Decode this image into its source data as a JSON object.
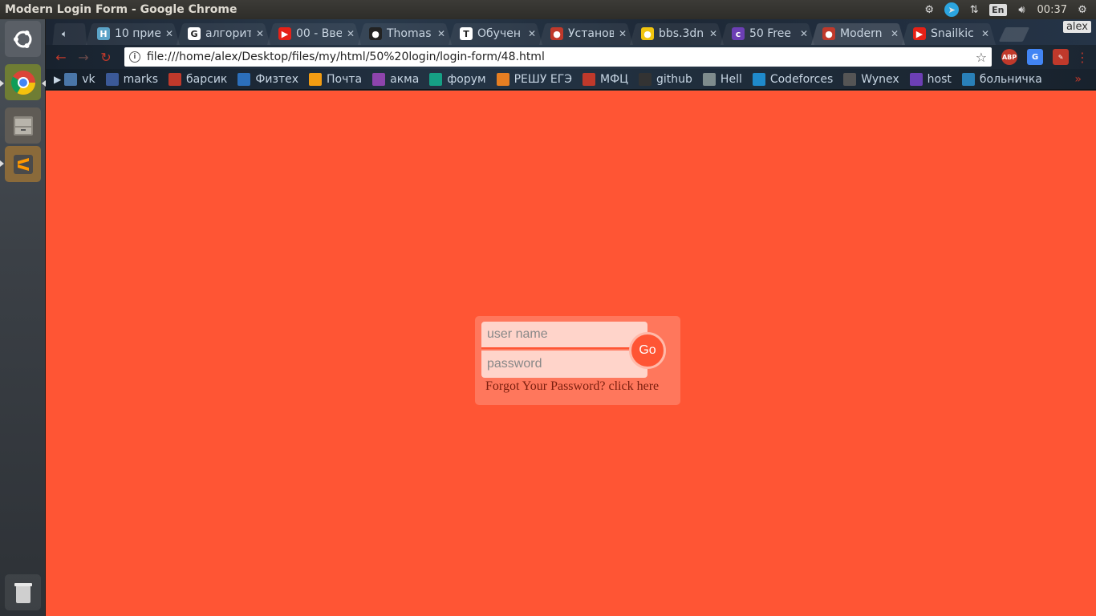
{
  "window": {
    "title": "Modern Login Form - Google Chrome"
  },
  "panel": {
    "lang": "En",
    "time": "00:37"
  },
  "tabs": [
    {
      "title": "10 прие",
      "favicon": "H",
      "color": "#5ba3c7"
    },
    {
      "title": "алгорит",
      "favicon": "G",
      "color": "#ffffff"
    },
    {
      "title": "00 - Вве",
      "favicon": "▶",
      "color": "#e62117"
    },
    {
      "title": "Thomas",
      "favicon": "●",
      "color": "#222222"
    },
    {
      "title": "Обучен",
      "favicon": "T",
      "color": "#ffffff"
    },
    {
      "title": "Установ",
      "favicon": "●",
      "color": "#c0392b"
    },
    {
      "title": "bbs.3dn",
      "favicon": "●",
      "color": "#f1c40f"
    },
    {
      "title": "50 Free",
      "favicon": "c",
      "color": "#6c3fb5"
    },
    {
      "title": "Modern",
      "favicon": "●",
      "color": "#c0392b"
    },
    {
      "title": "Snailkic",
      "favicon": "▶",
      "color": "#e62117"
    }
  ],
  "profile": "alex",
  "address_bar": {
    "url": "file:///home/alex/Desktop/files/my/html/50%20login/login-form/48.html"
  },
  "bookmarks": [
    {
      "label": "vk",
      "color": "#4a76a8"
    },
    {
      "label": "marks",
      "color": "#3b5998"
    },
    {
      "label": "барсик",
      "color": "#c0392b"
    },
    {
      "label": "Физтех",
      "color": "#2c6fbb"
    },
    {
      "label": "Почта",
      "color": "#f39c12"
    },
    {
      "label": "акма",
      "color": "#8e44ad"
    },
    {
      "label": "форум",
      "color": "#16a085"
    },
    {
      "label": "РЕШУ ЕГЭ",
      "color": "#e67e22"
    },
    {
      "label": "МФЦ",
      "color": "#c0392b"
    },
    {
      "label": "github",
      "color": "#333333"
    },
    {
      "label": "Hell",
      "color": "#7f8c8d"
    },
    {
      "label": "Codeforces",
      "color": "#1f8acb"
    },
    {
      "label": "Wynex",
      "color": "#555555"
    },
    {
      "label": "host",
      "color": "#6c3fb5"
    },
    {
      "label": "больничка",
      "color": "#2980b9"
    }
  ],
  "login": {
    "username_placeholder": "user name",
    "password_placeholder": "password",
    "go_label": "Go",
    "forgot_text": "Forgot Your Password? click here"
  },
  "colors": {
    "page_bg": "#ff5534",
    "field_bg": "#ffd4ca"
  }
}
